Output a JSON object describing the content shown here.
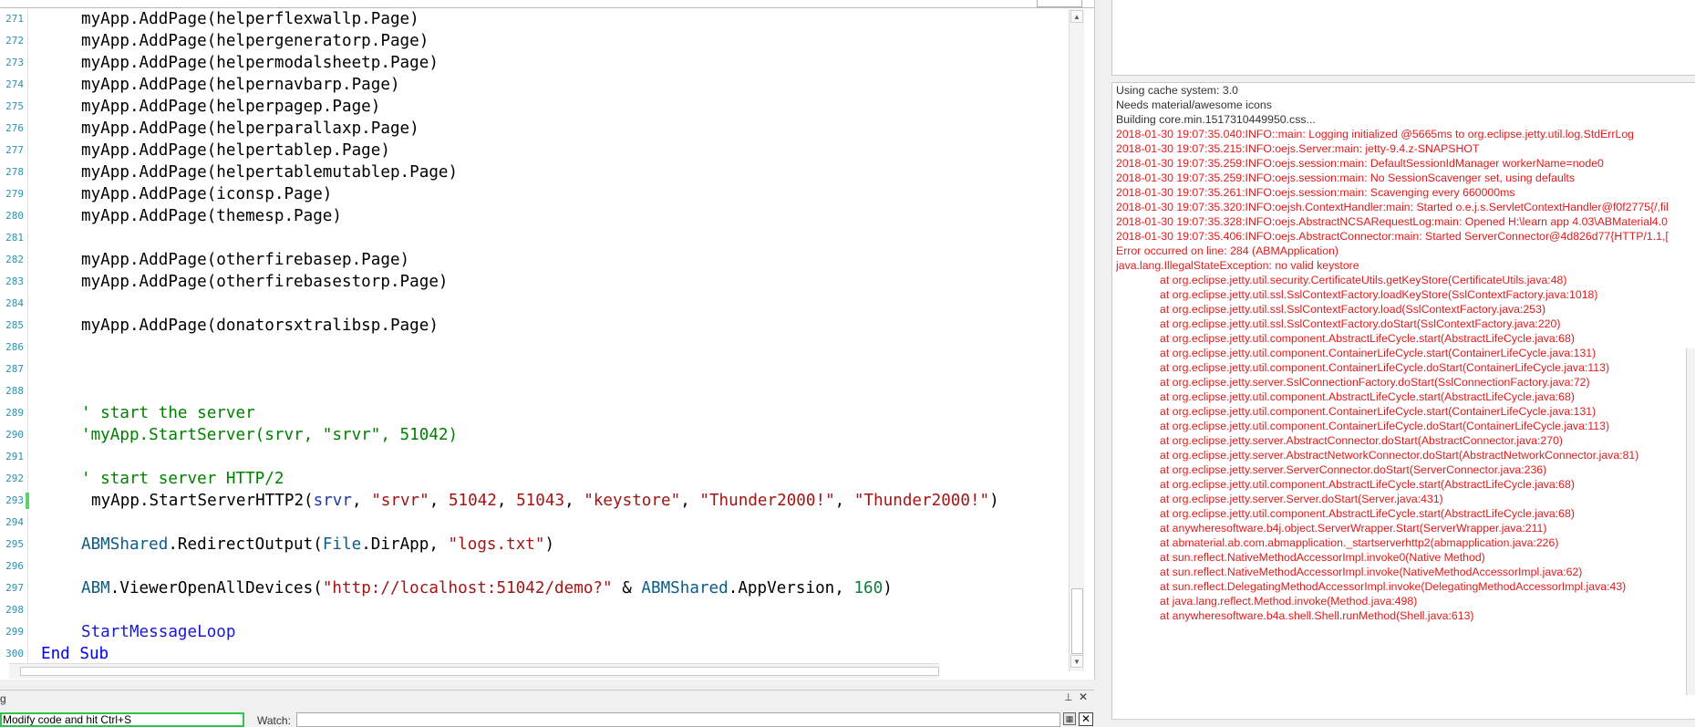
{
  "editor": {
    "code_lines": [
      {
        "n": "271",
        "tokens": [
          {
            "t": "myApp.AddPage(helperflexwallp.Page)",
            "c": ""
          }
        ]
      },
      {
        "n": "272",
        "tokens": [
          {
            "t": "myApp.AddPage(helpergeneratorp.Page)",
            "c": ""
          }
        ]
      },
      {
        "n": "273",
        "tokens": [
          {
            "t": "myApp.AddPage(helpermodalsheetp.Page)",
            "c": ""
          }
        ]
      },
      {
        "n": "274",
        "tokens": [
          {
            "t": "myApp.AddPage(helpernavbarp.Page)",
            "c": ""
          }
        ]
      },
      {
        "n": "275",
        "tokens": [
          {
            "t": "myApp.AddPage(helperpagep.Page)",
            "c": ""
          }
        ]
      },
      {
        "n": "276",
        "tokens": [
          {
            "t": "myApp.AddPage(helperparallaxp.Page)",
            "c": ""
          }
        ]
      },
      {
        "n": "277",
        "tokens": [
          {
            "t": "myApp.AddPage(helpertablep.Page)",
            "c": ""
          }
        ]
      },
      {
        "n": "278",
        "tokens": [
          {
            "t": "myApp.AddPage(helpertablemutablep.Page)",
            "c": ""
          }
        ]
      },
      {
        "n": "279",
        "tokens": [
          {
            "t": "myApp.AddPage(iconsp.Page)",
            "c": ""
          }
        ]
      },
      {
        "n": "280",
        "tokens": [
          {
            "t": "myApp.AddPage(themesp.Page)",
            "c": ""
          }
        ]
      },
      {
        "n": "281",
        "tokens": []
      },
      {
        "n": "282",
        "tokens": [
          {
            "t": "myApp.AddPage(otherfirebasep.Page)",
            "c": ""
          }
        ]
      },
      {
        "n": "283",
        "tokens": [
          {
            "t": "myApp.AddPage(otherfirebasestorp.Page)",
            "c": ""
          }
        ]
      },
      {
        "n": "284",
        "tokens": []
      },
      {
        "n": "285",
        "tokens": [
          {
            "t": "myApp.AddPage(donatorsxtralibsp.Page)",
            "c": ""
          }
        ]
      },
      {
        "n": "286",
        "tokens": []
      },
      {
        "n": "287",
        "tokens": []
      },
      {
        "n": "288",
        "tokens": []
      },
      {
        "n": "289",
        "tokens": [
          {
            "t": "' start the server",
            "c": "t-com"
          }
        ]
      },
      {
        "n": "290",
        "tokens": [
          {
            "t": "'myApp.StartServer(srvr, \"srvr\", 51042)",
            "c": "t-com"
          }
        ]
      },
      {
        "n": "291",
        "tokens": []
      },
      {
        "n": "292",
        "tokens": [
          {
            "t": "' start server HTTP/2",
            "c": "t-com"
          }
        ]
      },
      {
        "n": "293",
        "changed": true,
        "indent2": true,
        "tokens": [
          {
            "t": "myApp.StartServerHTTP2(",
            "c": ""
          },
          {
            "t": "srvr",
            "c": "t-var"
          },
          {
            "t": ", ",
            "c": ""
          },
          {
            "t": "\"srvr\"",
            "c": "t-str"
          },
          {
            "t": ", ",
            "c": ""
          },
          {
            "t": "51042",
            "c": "t-str"
          },
          {
            "t": ", ",
            "c": ""
          },
          {
            "t": "51043",
            "c": "t-str"
          },
          {
            "t": ", ",
            "c": ""
          },
          {
            "t": "\"keystore\"",
            "c": "t-str"
          },
          {
            "t": ", ",
            "c": ""
          },
          {
            "t": "\"Thunder2000!\"",
            "c": "t-str"
          },
          {
            "t": ", ",
            "c": ""
          },
          {
            "t": "\"Thunder2000!\"",
            "c": "t-str"
          },
          {
            "t": ")",
            "c": ""
          }
        ]
      },
      {
        "n": "294",
        "tokens": []
      },
      {
        "n": "295",
        "tokens": [
          {
            "t": "ABMShared",
            "c": "t-cls"
          },
          {
            "t": ".RedirectOutput(",
            "c": ""
          },
          {
            "t": "File",
            "c": "t-cls"
          },
          {
            "t": ".DirApp, ",
            "c": ""
          },
          {
            "t": "\"logs.txt\"",
            "c": "t-str"
          },
          {
            "t": ")",
            "c": ""
          }
        ]
      },
      {
        "n": "296",
        "tokens": []
      },
      {
        "n": "297",
        "tokens": [
          {
            "t": "ABM",
            "c": "t-cls"
          },
          {
            "t": ".ViewerOpenAllDevices(",
            "c": ""
          },
          {
            "t": "\"http://localhost:51042/demo?\"",
            "c": "t-str"
          },
          {
            "t": " & ",
            "c": ""
          },
          {
            "t": "ABMShared",
            "c": "t-cls"
          },
          {
            "t": ".AppVersion, ",
            "c": ""
          },
          {
            "t": "160",
            "c": "t-num"
          },
          {
            "t": ")",
            "c": ""
          }
        ]
      },
      {
        "n": "298",
        "tokens": []
      },
      {
        "n": "299",
        "tokens": [
          {
            "t": "StartMessageLoop",
            "c": "t-sub"
          }
        ]
      },
      {
        "n": "300",
        "outdent": true,
        "tokens": [
          {
            "t": "End Sub",
            "c": "t-kw"
          }
        ]
      }
    ]
  },
  "bottom_panel": {
    "title": "g",
    "input_value": "Modify code and hit Ctrl+S",
    "watch_label": "Watch:",
    "pin_glyph": "⊥",
    "close_glyph": "✕"
  },
  "log": {
    "lines": [
      {
        "text": "Using cache system: 3.0",
        "kind": "info"
      },
      {
        "text": "Needs material/awesome icons",
        "kind": "info"
      },
      {
        "text": "Building core.min.1517310449950.css...",
        "kind": "info"
      },
      {
        "text": "2018-01-30 19:07:35.040:INFO::main: Logging initialized @5665ms to org.eclipse.jetty.util.log.StdErrLog",
        "kind": "err"
      },
      {
        "text": "2018-01-30 19:07:35.215:INFO:oejs.Server:main: jetty-9.4.z-SNAPSHOT",
        "kind": "err"
      },
      {
        "text": "2018-01-30 19:07:35.259:INFO:oejs.session:main: DefaultSessionIdManager workerName=node0",
        "kind": "err"
      },
      {
        "text": "2018-01-30 19:07:35.259:INFO:oejs.session:main: No SessionScavenger set, using defaults",
        "kind": "err"
      },
      {
        "text": "2018-01-30 19:07:35.261:INFO:oejs.session:main: Scavenging every 660000ms",
        "kind": "err"
      },
      {
        "text": "2018-01-30 19:07:35.320:INFO:oejsh.ContextHandler:main: Started o.e.j.s.ServletContextHandler@f0f2775{/,fil",
        "kind": "err"
      },
      {
        "text": "2018-01-30 19:07:35.328:INFO:oejs.AbstractNCSARequestLog:main: Opened H:\\learn app 4.03\\ABMaterial4.0",
        "kind": "err"
      },
      {
        "text": "2018-01-30 19:07:35.406:INFO:oejs.AbstractConnector:main: Started ServerConnector@4d826d77{HTTP/1.1,[",
        "kind": "err"
      },
      {
        "text": "Error occurred on line: 284 (ABMApplication)",
        "kind": "err"
      },
      {
        "text": "java.lang.IllegalStateException: no valid keystore",
        "kind": "err"
      },
      {
        "text": "at org.eclipse.jetty.util.security.CertificateUtils.getKeyStore(CertificateUtils.java:48)",
        "kind": "err",
        "at": true
      },
      {
        "text": "at org.eclipse.jetty.util.ssl.SslContextFactory.loadKeyStore(SslContextFactory.java:1018)",
        "kind": "err",
        "at": true
      },
      {
        "text": "at org.eclipse.jetty.util.ssl.SslContextFactory.load(SslContextFactory.java:253)",
        "kind": "err",
        "at": true
      },
      {
        "text": "at org.eclipse.jetty.util.ssl.SslContextFactory.doStart(SslContextFactory.java:220)",
        "kind": "err",
        "at": true
      },
      {
        "text": "at org.eclipse.jetty.util.component.AbstractLifeCycle.start(AbstractLifeCycle.java:68)",
        "kind": "err",
        "at": true
      },
      {
        "text": "at org.eclipse.jetty.util.component.ContainerLifeCycle.start(ContainerLifeCycle.java:131)",
        "kind": "err",
        "at": true
      },
      {
        "text": "at org.eclipse.jetty.util.component.ContainerLifeCycle.doStart(ContainerLifeCycle.java:113)",
        "kind": "err",
        "at": true
      },
      {
        "text": "at org.eclipse.jetty.server.SslConnectionFactory.doStart(SslConnectionFactory.java:72)",
        "kind": "err",
        "at": true
      },
      {
        "text": "at org.eclipse.jetty.util.component.AbstractLifeCycle.start(AbstractLifeCycle.java:68)",
        "kind": "err",
        "at": true
      },
      {
        "text": "at org.eclipse.jetty.util.component.ContainerLifeCycle.start(ContainerLifeCycle.java:131)",
        "kind": "err",
        "at": true
      },
      {
        "text": "at org.eclipse.jetty.util.component.ContainerLifeCycle.doStart(ContainerLifeCycle.java:113)",
        "kind": "err",
        "at": true
      },
      {
        "text": "at org.eclipse.jetty.server.AbstractConnector.doStart(AbstractConnector.java:270)",
        "kind": "err",
        "at": true
      },
      {
        "text": "at org.eclipse.jetty.server.AbstractNetworkConnector.doStart(AbstractNetworkConnector.java:81)",
        "kind": "err",
        "at": true
      },
      {
        "text": "at org.eclipse.jetty.server.ServerConnector.doStart(ServerConnector.java:236)",
        "kind": "err",
        "at": true
      },
      {
        "text": "at org.eclipse.jetty.util.component.AbstractLifeCycle.start(AbstractLifeCycle.java:68)",
        "kind": "err",
        "at": true
      },
      {
        "text": "at org.eclipse.jetty.server.Server.doStart(Server.java:431)",
        "kind": "err",
        "at": true
      },
      {
        "text": "at org.eclipse.jetty.util.component.AbstractLifeCycle.start(AbstractLifeCycle.java:68)",
        "kind": "err",
        "at": true
      },
      {
        "text": "at anywheresoftware.b4j.object.ServerWrapper.Start(ServerWrapper.java:211)",
        "kind": "err",
        "at": true
      },
      {
        "text": "at abmaterial.ab.com.abmapplication._startserverhttp2(abmapplication.java:226)",
        "kind": "err",
        "at": true
      },
      {
        "text": "at sun.reflect.NativeMethodAccessorImpl.invoke0(Native Method)",
        "kind": "err",
        "at": true
      },
      {
        "text": "at sun.reflect.NativeMethodAccessorImpl.invoke(NativeMethodAccessorImpl.java:62)",
        "kind": "err",
        "at": true
      },
      {
        "text": "at sun.reflect.DelegatingMethodAccessorImpl.invoke(DelegatingMethodAccessorImpl.java:43)",
        "kind": "err",
        "at": true
      },
      {
        "text": "at java.lang.reflect.Method.invoke(Method.java:498)",
        "kind": "err",
        "at": true
      },
      {
        "text": "at anywheresoftware.b4a.shell.Shell.runMethod(Shell.java:613)",
        "kind": "err",
        "at": true
      }
    ]
  },
  "colors": {
    "log_error": "#e01b1b",
    "log_info": "#333333",
    "comment": "#008000",
    "string": "#a31515",
    "keyword": "#0000ff",
    "line_number": "#2b91af",
    "change_bar": "#5bd36b"
  }
}
